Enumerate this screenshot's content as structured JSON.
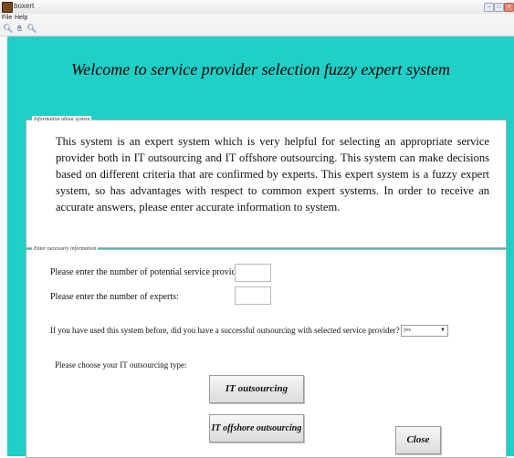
{
  "window": {
    "title": "boxert",
    "menu": [
      "File",
      "Help"
    ],
    "toolbar_icons": [
      "zoom-in-icon",
      "pan-icon",
      "zoom-out-icon"
    ]
  },
  "heading": "Welcome to service provider selection fuzzy expert system",
  "info_panel": {
    "label": "Information about system",
    "text": "This system is an expert system which is very helpful for selecting an appropriate service provider both in IT outsourcing and IT offshore outsourcing. This system can make decisions based on different criteria that are confirmed by experts. This expert system is a fuzzy expert system, so has advantages with respect to common expert systems. In order to receive an accurate answers, please enter accurate information to system."
  },
  "input_panel": {
    "label": "Enter necessary information",
    "providers_label": "Please enter the number of potential service providers :",
    "providers_value": "",
    "experts_label": "Please enter the number of experts:",
    "experts_value": "",
    "history_label": "If you have used this system before, did you have a successful outsourcing with selected service provider?",
    "history_value": "yes",
    "type_label": "Please choose your IT outsourcing type:",
    "it_outsourcing_button": "IT outsourcing",
    "it_offshore_button": "IT offshore outsourcing",
    "close_button": "Close"
  }
}
